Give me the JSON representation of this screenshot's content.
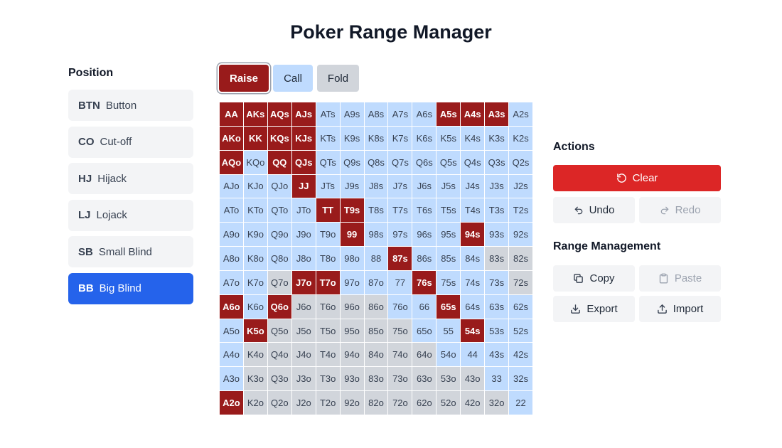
{
  "title": "Poker Range Manager",
  "position_panel": {
    "heading": "Position",
    "items": [
      {
        "abbr": "BTN",
        "label": "Button"
      },
      {
        "abbr": "CO",
        "label": "Cut-off"
      },
      {
        "abbr": "HJ",
        "label": "Hijack"
      },
      {
        "abbr": "LJ",
        "label": "Lojack"
      },
      {
        "abbr": "SB",
        "label": "Small Blind"
      },
      {
        "abbr": "BB",
        "label": "Big Blind"
      }
    ],
    "selected": "BB"
  },
  "action_buttons": {
    "raise": "Raise",
    "call": "Call",
    "fold": "Fold",
    "selected": "Raise"
  },
  "colors": {
    "raise": "#991b1b",
    "call": "#bfdbfe",
    "fold": "#d1d5db",
    "active_position": "#2563eb",
    "clear": "#dc2626"
  },
  "range_grid": [
    [
      [
        "AA",
        "raise"
      ],
      [
        "AKs",
        "raise"
      ],
      [
        "AQs",
        "raise"
      ],
      [
        "AJs",
        "raise"
      ],
      [
        "ATs",
        "call"
      ],
      [
        "A9s",
        "call"
      ],
      [
        "A8s",
        "call"
      ],
      [
        "A7s",
        "call"
      ],
      [
        "A6s",
        "call"
      ],
      [
        "A5s",
        "raise"
      ],
      [
        "A4s",
        "raise"
      ],
      [
        "A3s",
        "raise"
      ],
      [
        "A2s",
        "call"
      ]
    ],
    [
      [
        "AKo",
        "raise"
      ],
      [
        "KK",
        "raise"
      ],
      [
        "KQs",
        "raise"
      ],
      [
        "KJs",
        "raise"
      ],
      [
        "KTs",
        "call"
      ],
      [
        "K9s",
        "call"
      ],
      [
        "K8s",
        "call"
      ],
      [
        "K7s",
        "call"
      ],
      [
        "K6s",
        "call"
      ],
      [
        "K5s",
        "call"
      ],
      [
        "K4s",
        "call"
      ],
      [
        "K3s",
        "call"
      ],
      [
        "K2s",
        "call"
      ]
    ],
    [
      [
        "AQo",
        "raise"
      ],
      [
        "KQo",
        "call"
      ],
      [
        "QQ",
        "raise"
      ],
      [
        "QJs",
        "raise"
      ],
      [
        "QTs",
        "call"
      ],
      [
        "Q9s",
        "call"
      ],
      [
        "Q8s",
        "call"
      ],
      [
        "Q7s",
        "call"
      ],
      [
        "Q6s",
        "call"
      ],
      [
        "Q5s",
        "call"
      ],
      [
        "Q4s",
        "call"
      ],
      [
        "Q3s",
        "call"
      ],
      [
        "Q2s",
        "call"
      ]
    ],
    [
      [
        "AJo",
        "call"
      ],
      [
        "KJo",
        "call"
      ],
      [
        "QJo",
        "call"
      ],
      [
        "JJ",
        "raise"
      ],
      [
        "JTs",
        "call"
      ],
      [
        "J9s",
        "call"
      ],
      [
        "J8s",
        "call"
      ],
      [
        "J7s",
        "call"
      ],
      [
        "J6s",
        "call"
      ],
      [
        "J5s",
        "call"
      ],
      [
        "J4s",
        "call"
      ],
      [
        "J3s",
        "call"
      ],
      [
        "J2s",
        "call"
      ]
    ],
    [
      [
        "ATo",
        "call"
      ],
      [
        "KTo",
        "call"
      ],
      [
        "QTo",
        "call"
      ],
      [
        "JTo",
        "call"
      ],
      [
        "TT",
        "raise"
      ],
      [
        "T9s",
        "raise"
      ],
      [
        "T8s",
        "call"
      ],
      [
        "T7s",
        "call"
      ],
      [
        "T6s",
        "call"
      ],
      [
        "T5s",
        "call"
      ],
      [
        "T4s",
        "call"
      ],
      [
        "T3s",
        "call"
      ],
      [
        "T2s",
        "call"
      ]
    ],
    [
      [
        "A9o",
        "call"
      ],
      [
        "K9o",
        "call"
      ],
      [
        "Q9o",
        "call"
      ],
      [
        "J9o",
        "call"
      ],
      [
        "T9o",
        "call"
      ],
      [
        "99",
        "raise"
      ],
      [
        "98s",
        "call"
      ],
      [
        "97s",
        "call"
      ],
      [
        "96s",
        "call"
      ],
      [
        "95s",
        "call"
      ],
      [
        "94s",
        "raise"
      ],
      [
        "93s",
        "call"
      ],
      [
        "92s",
        "call"
      ]
    ],
    [
      [
        "A8o",
        "call"
      ],
      [
        "K8o",
        "call"
      ],
      [
        "Q8o",
        "call"
      ],
      [
        "J8o",
        "call"
      ],
      [
        "T8o",
        "call"
      ],
      [
        "98o",
        "call"
      ],
      [
        "88",
        "call"
      ],
      [
        "87s",
        "raise"
      ],
      [
        "86s",
        "call"
      ],
      [
        "85s",
        "call"
      ],
      [
        "84s",
        "call"
      ],
      [
        "83s",
        "fold"
      ],
      [
        "82s",
        "fold"
      ]
    ],
    [
      [
        "A7o",
        "call"
      ],
      [
        "K7o",
        "call"
      ],
      [
        "Q7o",
        "fold"
      ],
      [
        "J7o",
        "raise"
      ],
      [
        "T7o",
        "raise"
      ],
      [
        "97o",
        "call"
      ],
      [
        "87o",
        "call"
      ],
      [
        "77",
        "call"
      ],
      [
        "76s",
        "raise"
      ],
      [
        "75s",
        "call"
      ],
      [
        "74s",
        "call"
      ],
      [
        "73s",
        "call"
      ],
      [
        "72s",
        "fold"
      ]
    ],
    [
      [
        "A6o",
        "raise"
      ],
      [
        "K6o",
        "call"
      ],
      [
        "Q6o",
        "raise"
      ],
      [
        "J6o",
        "fold"
      ],
      [
        "T6o",
        "fold"
      ],
      [
        "96o",
        "fold"
      ],
      [
        "86o",
        "fold"
      ],
      [
        "76o",
        "call"
      ],
      [
        "66",
        "call"
      ],
      [
        "65s",
        "raise"
      ],
      [
        "64s",
        "call"
      ],
      [
        "63s",
        "call"
      ],
      [
        "62s",
        "call"
      ]
    ],
    [
      [
        "A5o",
        "call"
      ],
      [
        "K5o",
        "raise"
      ],
      [
        "Q5o",
        "fold"
      ],
      [
        "J5o",
        "fold"
      ],
      [
        "T5o",
        "fold"
      ],
      [
        "95o",
        "fold"
      ],
      [
        "85o",
        "fold"
      ],
      [
        "75o",
        "fold"
      ],
      [
        "65o",
        "call"
      ],
      [
        "55",
        "call"
      ],
      [
        "54s",
        "raise"
      ],
      [
        "53s",
        "call"
      ],
      [
        "52s",
        "call"
      ]
    ],
    [
      [
        "A4o",
        "call"
      ],
      [
        "K4o",
        "fold"
      ],
      [
        "Q4o",
        "fold"
      ],
      [
        "J4o",
        "fold"
      ],
      [
        "T4o",
        "fold"
      ],
      [
        "94o",
        "fold"
      ],
      [
        "84o",
        "fold"
      ],
      [
        "74o",
        "fold"
      ],
      [
        "64o",
        "fold"
      ],
      [
        "54o",
        "call"
      ],
      [
        "44",
        "call"
      ],
      [
        "43s",
        "call"
      ],
      [
        "42s",
        "call"
      ]
    ],
    [
      [
        "A3o",
        "call"
      ],
      [
        "K3o",
        "fold"
      ],
      [
        "Q3o",
        "fold"
      ],
      [
        "J3o",
        "fold"
      ],
      [
        "T3o",
        "fold"
      ],
      [
        "93o",
        "fold"
      ],
      [
        "83o",
        "fold"
      ],
      [
        "73o",
        "fold"
      ],
      [
        "63o",
        "fold"
      ],
      [
        "53o",
        "fold"
      ],
      [
        "43o",
        "fold"
      ],
      [
        "33",
        "call"
      ],
      [
        "32s",
        "call"
      ]
    ],
    [
      [
        "A2o",
        "raise"
      ],
      [
        "K2o",
        "fold"
      ],
      [
        "Q2o",
        "fold"
      ],
      [
        "J2o",
        "fold"
      ],
      [
        "T2o",
        "fold"
      ],
      [
        "92o",
        "fold"
      ],
      [
        "82o",
        "fold"
      ],
      [
        "72o",
        "fold"
      ],
      [
        "62o",
        "fold"
      ],
      [
        "52o",
        "fold"
      ],
      [
        "42o",
        "fold"
      ],
      [
        "32o",
        "fold"
      ],
      [
        "22",
        "call"
      ]
    ]
  ],
  "actions": {
    "heading": "Actions",
    "clear": "Clear",
    "undo": "Undo",
    "redo": "Redo",
    "redo_disabled": true
  },
  "range_management": {
    "heading": "Range Management",
    "copy": "Copy",
    "paste": "Paste",
    "paste_disabled": true,
    "export": "Export",
    "import": "Import"
  },
  "icons": {
    "clear": "rotate-ccw-icon",
    "undo": "undo-icon",
    "redo": "redo-icon",
    "copy": "copy-icon",
    "paste": "clipboard-icon",
    "export": "download-icon",
    "import": "upload-icon"
  }
}
